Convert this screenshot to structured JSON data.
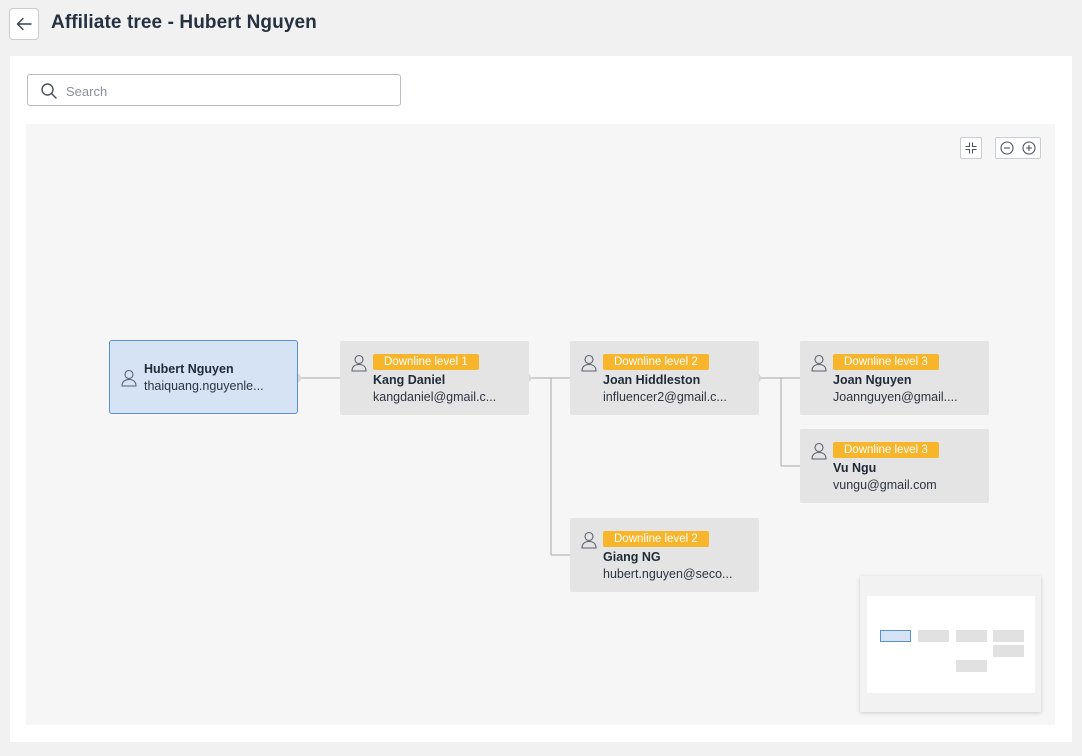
{
  "header": {
    "back_label": "Back",
    "title": "Affiliate tree - Hubert Nguyen"
  },
  "search": {
    "placeholder": "Search",
    "value": ""
  },
  "controls": {
    "fit_icon": "compress-icon",
    "zoom_out_icon": "zoom-out-icon",
    "zoom_in_icon": "zoom-in-icon"
  },
  "tree": {
    "root": {
      "name": "Hubert Nguyen",
      "email": "thaiquang.nguyenle..."
    },
    "nodes": [
      {
        "level": "Downline level 1",
        "name": "Kang Daniel",
        "email": "kangdaniel@gmail.c..."
      },
      {
        "level": "Downline level 2",
        "name": "Joan Hiddleston",
        "email": "influencer2@gmail.c..."
      },
      {
        "level": "Downline level 3",
        "name": "Joan Nguyen",
        "email": "Joannguyen@gmail...."
      },
      {
        "level": "Downline level 3",
        "name": "Vu Ngu",
        "email": "vungu@gmail.com"
      },
      {
        "level": "Downline level 2",
        "name": "Giang NG",
        "email": "hubert.nguyen@seco..."
      }
    ]
  },
  "colors": {
    "badge": "#f7b52b",
    "root_fill": "#d5e3f5",
    "root_border": "#5b8fd0",
    "node_fill": "#e4e4e4",
    "canvas": "#f6f6f6"
  }
}
